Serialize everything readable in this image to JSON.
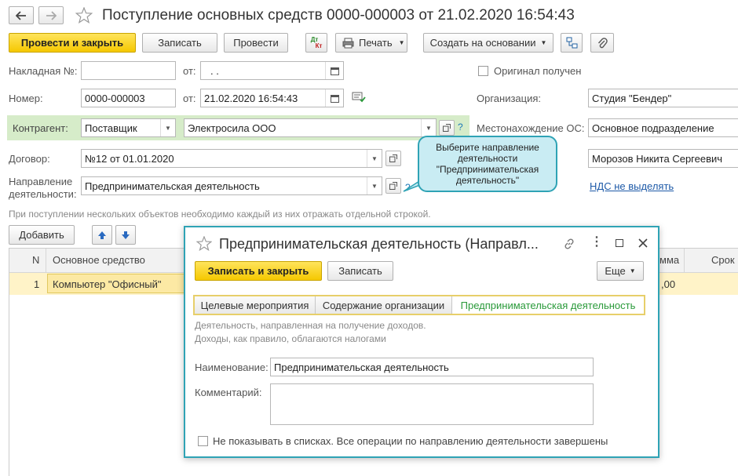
{
  "nav": {
    "back_icon": "back-arrow-icon",
    "forward_icon": "forward-arrow-icon"
  },
  "document": {
    "title": "Поступление основных средств 0000-000003 от 21.02.2020 16:54:43"
  },
  "toolbar": {
    "post_close_label": "Провести и закрыть",
    "save_label": "Записать",
    "post_label": "Провести",
    "dt_kt_label_top": "Дт",
    "dt_kt_label_bottom": "Кт",
    "print_label": "Печать",
    "create_based_label": "Создать на основании"
  },
  "form": {
    "invoice_label": "Накладная №:",
    "invoice_value": "",
    "from_label": "от:",
    "invoice_date": ".  .",
    "original_label": "Оригинал получен",
    "number_label": "Номер:",
    "number_value": "0000-000003",
    "number_date": "21.02.2020 16:54:43",
    "org_label": "Организация:",
    "org_value": "Студия \"Бендер\"",
    "counterparty_label": "Контрагент:",
    "counterparty_type": "Поставщик",
    "counterparty_value": "Электросила ООО",
    "help_mark": "?",
    "location_label": "Местонахождение ОС:",
    "location_value": "Основное подразделение",
    "contract_label": "Договор:",
    "contract_value": "№12 от 01.01.2020",
    "responsible_value": "Морозов Никита Сергеевич",
    "activity_label_1": "Направление",
    "activity_label_2": "деятельности:",
    "activity_value": "Предпринимательская деятельность",
    "vat_link": "НДС не выделять",
    "hint_text": "При поступлении нескольких объектов необходимо каждый из них отражать отдельной строкой."
  },
  "callout": {
    "text": "Выберите направление деятельности \"Предпринимательская деятельность\""
  },
  "table": {
    "add_label": "Добавить",
    "col_n": "N",
    "col_asset": "Основное средство",
    "col_sum_partial": "мма",
    "col_term_partial": "Срок",
    "rows": [
      {
        "n": "1",
        "asset": "Компьютер \"Офисный\"",
        "sum_partial": ",00"
      }
    ]
  },
  "dialog": {
    "title": "Предпринимательская деятельность (Направл...",
    "save_close_label": "Записать и закрыть",
    "save_label": "Записать",
    "more_label": "Еще",
    "tabs": [
      {
        "label": "Целевые мероприятия"
      },
      {
        "label": "Содержание организации"
      },
      {
        "label": "Предпринимательская деятельность"
      }
    ],
    "description_1": "Деятельность, направленная на получение доходов.",
    "description_2": "Доходы, как правило, облагаются налогами",
    "name_label": "Наименование:",
    "name_value": "Предпринимательская деятельность",
    "comment_label": "Комментарий:",
    "comment_value": "",
    "hide_label": "Не показывать в списках. Все операции по направлению деятельности завершены"
  },
  "colors": {
    "accent_yellow": "#f5c800",
    "dialog_border": "#2fa3b5",
    "counterparty_bg": "#d6ecc9",
    "link_blue": "#1e5aa8",
    "active_tab_green": "#2a9a3a",
    "row_highlight": "#fff3c8"
  }
}
